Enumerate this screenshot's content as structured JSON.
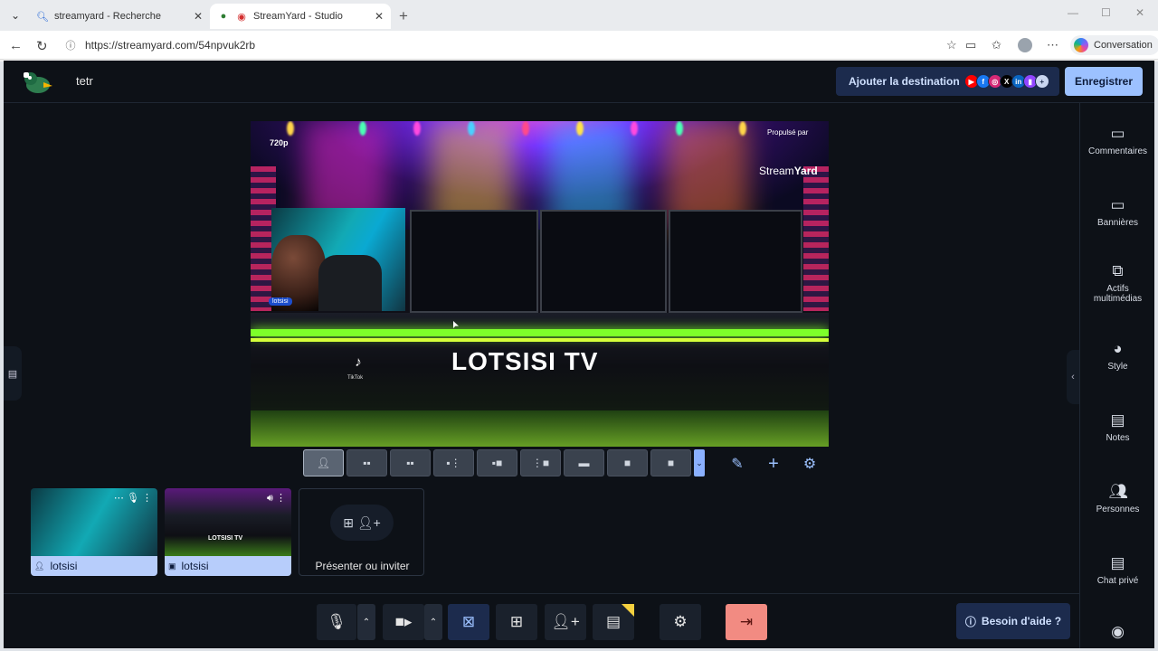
{
  "browser": {
    "tabs": [
      {
        "title": "streamyard - Recherche",
        "icon": "search-icon"
      },
      {
        "title": "StreamYard - Studio",
        "icon": "streamyard-icon"
      }
    ],
    "url": "https://streamyard.com/54npvuk2rb",
    "conversation_label": "Conversation"
  },
  "app": {
    "studio_name": "tetr",
    "add_destination_label": "Ajouter la destination",
    "record_label": "Enregistrer",
    "destination_icons": [
      "youtube",
      "facebook",
      "instagram",
      "x",
      "linkedin",
      "twitch",
      "plus"
    ]
  },
  "stage": {
    "resolution": "720p",
    "powered_by": "Propulsé par",
    "brand_left": "Stream",
    "brand_right": "Yard",
    "camera_tag": "lotsisi",
    "title": "LOTSISI TV",
    "tiktok_label": "TikTok"
  },
  "sidebar": {
    "items": [
      {
        "label": "Commentaires",
        "icon": "comment-icon"
      },
      {
        "label": "Bannières",
        "icon": "banner-icon"
      },
      {
        "label": "Actifs multimédias",
        "icon": "media-icon"
      },
      {
        "label": "Style",
        "icon": "palette-icon"
      },
      {
        "label": "Notes",
        "icon": "notes-icon"
      },
      {
        "label": "Personnes",
        "icon": "people-icon"
      },
      {
        "label": "Chat privé",
        "icon": "chat-icon"
      }
    ]
  },
  "thumbnails": [
    {
      "label": "lotsisi",
      "type": "camera"
    },
    {
      "label": "lotsisi",
      "type": "screen",
      "mini_title": "LOTSISI TV"
    }
  ],
  "present_label": "Présenter ou inviter",
  "help_label": "Besoin d'aide ?"
}
